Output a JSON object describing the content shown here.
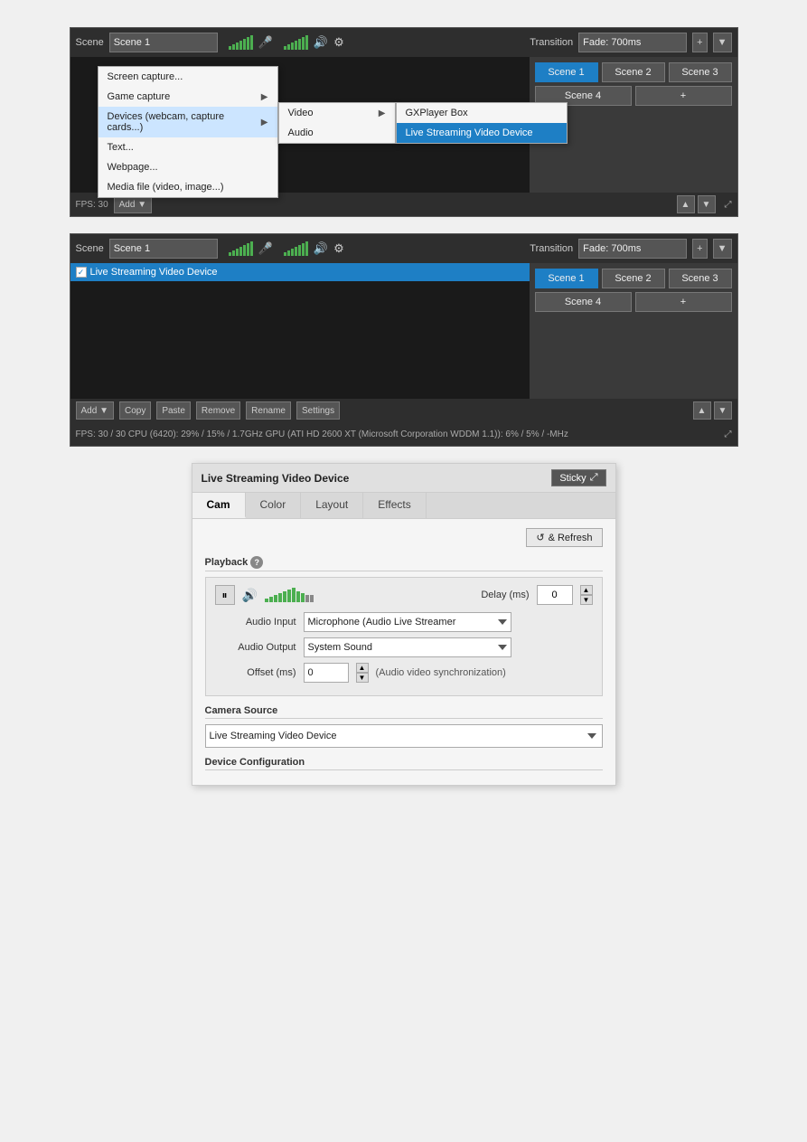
{
  "panel1": {
    "scene_label": "Scene",
    "scene_name": "Scene 1",
    "transition_label": "Transition",
    "transition_value": "Fade: 700ms",
    "scenes": [
      "Scene 1",
      "Scene 2",
      "Scene 3",
      "Scene 4",
      "+"
    ],
    "fps_info": "FPS:  30",
    "context_menu": {
      "items": [
        {
          "label": "Screen capture...",
          "has_arrow": false
        },
        {
          "label": "Game capture",
          "has_arrow": true
        },
        {
          "label": "Devices (webcam, capture cards...)",
          "has_arrow": true
        },
        {
          "label": "Text...",
          "has_arrow": false
        },
        {
          "label": "Webpage...",
          "has_arrow": false
        },
        {
          "label": "Media file (video, image...)",
          "has_arrow": false
        }
      ],
      "submenu_video": [
        {
          "label": "Video",
          "has_arrow": true
        },
        {
          "label": "Audio",
          "has_arrow": false
        }
      ],
      "submenu_devices": [
        {
          "label": "GXPlayer Box",
          "highlighted": false
        },
        {
          "label": "Live Streaming Video Device",
          "highlighted": true
        }
      ]
    }
  },
  "panel2": {
    "scene_label": "Scene",
    "scene_name": "Scene 1",
    "transition_label": "Transition",
    "transition_value": "Fade: 700ms",
    "scenes": [
      "Scene 1",
      "Scene 2",
      "Scene 3",
      "Scene 4",
      "+"
    ],
    "source_item": "Live Streaming Video Device",
    "toolbar_buttons": [
      "Add",
      "Copy",
      "Paste",
      "Remove",
      "Rename",
      "Settings"
    ],
    "fps_info": "FPS:  30 / 30    CPU (6420):  29% / 15% / 1.7GHz     GPU (ATI HD 2600 XT (Microsoft Corporation WDDM 1.1)):   6% / 5% / -MHz"
  },
  "panel3": {
    "title": "Live Streaming Video Device",
    "sticky_label": "Sticky",
    "tabs": [
      "Cam",
      "Color",
      "Layout",
      "Effects"
    ],
    "active_tab": "Cam",
    "refresh_label": "& Refresh",
    "playback_label": "Playback",
    "delay_label": "Delay (ms)",
    "delay_value": "0",
    "audio_input_label": "Audio Input",
    "audio_input_value": "Microphone (Audio Live Streamer",
    "audio_output_label": "Audio Output",
    "audio_output_value": "System Sound",
    "offset_label": "Offset (ms)",
    "offset_value": "0",
    "sync_note": "(Audio video synchronization)",
    "camera_source_label": "Camera Source",
    "camera_source_value": "Live Streaming Video Device",
    "device_config_label": "Device Configuration"
  },
  "icons": {
    "signal": "▋▋▋▋▋",
    "mic": "🎤",
    "volume": "🔊",
    "settings": "⚙",
    "arrow_right": "▶",
    "arrow_up": "▲",
    "arrow_down": "▼",
    "check": "✓",
    "resize": "⤢",
    "refresh": "↺",
    "pause": "⏸",
    "speaker": "🔊"
  }
}
